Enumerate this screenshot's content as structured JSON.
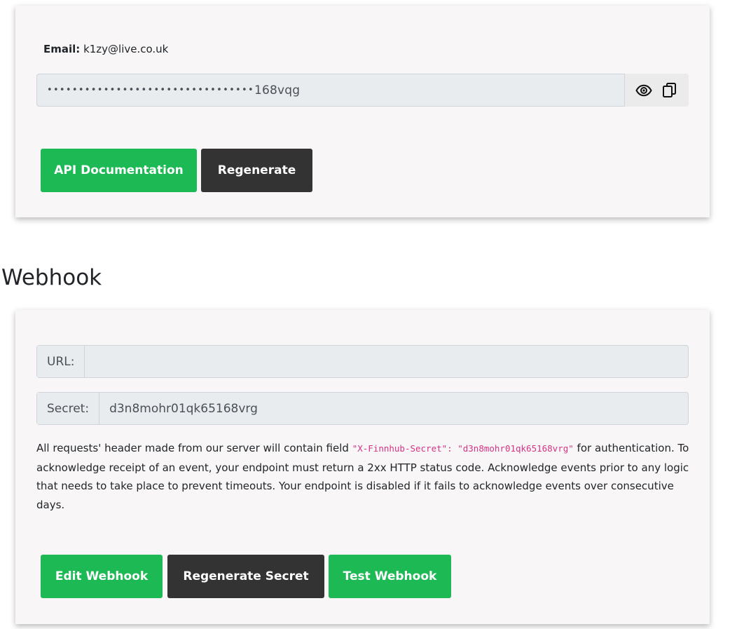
{
  "api_key_card": {
    "email_label": "Email:",
    "email_value": "k1zy@live.co.uk",
    "api_key_masked": "•••••••••••••••••••••••••••••••••",
    "api_key_suffix": "168vqg",
    "show_icon": "eye-icon",
    "copy_icon": "copy-icon",
    "buttons": {
      "docs": "API Documentation",
      "regenerate": "Regenerate"
    }
  },
  "webhook": {
    "title": "Webhook",
    "url_label": "URL:",
    "url_value": "",
    "secret_label": "Secret:",
    "secret_value": "d3n8mohr01qk65168vrg",
    "description": {
      "before_code": "All requests' header made from our server will contain field ",
      "code": "\"X-Finnhub-Secret\": \"d3n8mohr01qk65168vrg\"",
      "after_code": " for authentication. To acknowledge receipt of an event, your endpoint must return a 2xx HTTP status code. Acknowledge events prior to any logic that needs to take place to prevent timeouts. Your endpoint is disabled if it fails to acknowledge events over consecutive days."
    },
    "buttons": {
      "edit": "Edit Webhook",
      "regenerate_secret": "Regenerate Secret",
      "test": "Test Webhook"
    }
  },
  "colors": {
    "green": "#1db954",
    "dark": "#333333",
    "card_bg": "#f8f6f7",
    "code_pink": "#d63384"
  }
}
